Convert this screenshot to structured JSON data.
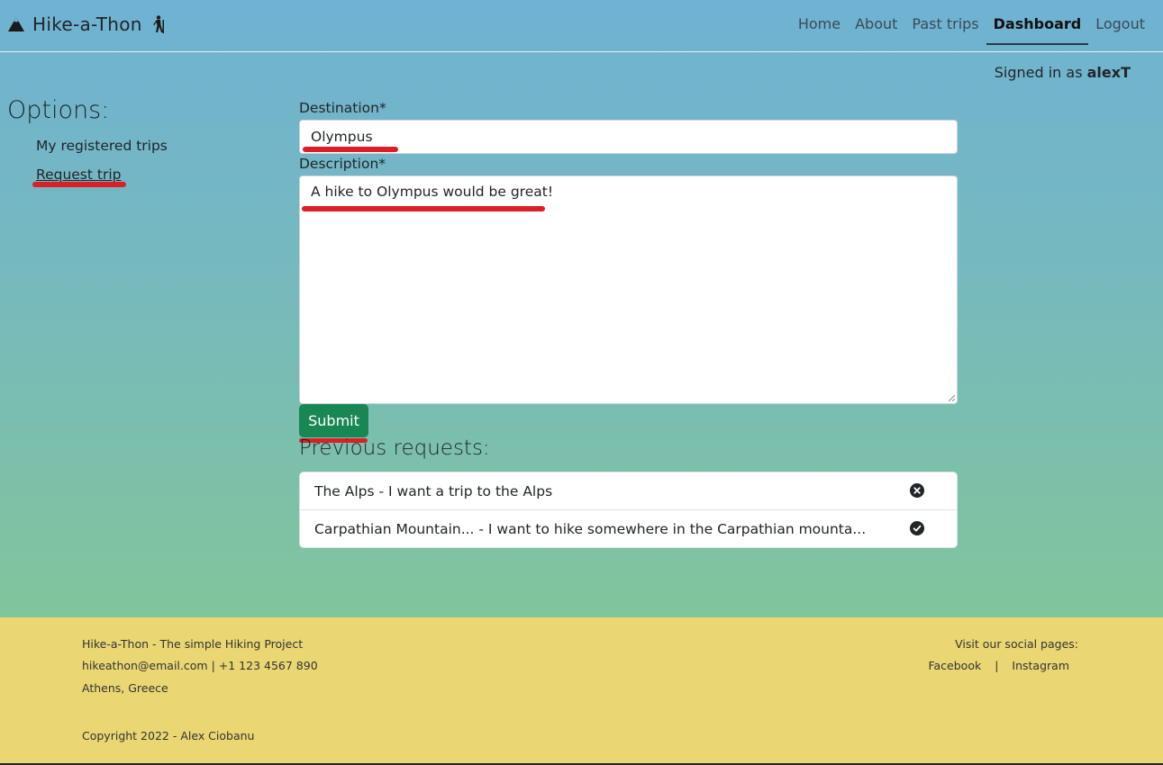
{
  "brand": {
    "name": "Hike-a-Thon"
  },
  "nav": {
    "home": "Home",
    "about": "About",
    "past": "Past trips",
    "dashboard": "Dashboard",
    "logout": "Logout"
  },
  "user": {
    "signed_prefix": "Signed in as",
    "name": "alexT"
  },
  "sidebar": {
    "title": "Options:",
    "items": [
      "My registered trips",
      "Request trip"
    ]
  },
  "form": {
    "dest_label": "Destination*",
    "dest_value": "Olympus",
    "desc_label": "Description*",
    "desc_value": "A hike to Olympus would be great!",
    "submit": "Submit"
  },
  "previous": {
    "title": "Previous requests:",
    "items": [
      {
        "text": "The Alps - I want a trip to the Alps",
        "status_icon": "times-circle-icon"
      },
      {
        "text": "Carpathian Mountain... - I want to hike somewhere in the Carpathian mounta...",
        "status_icon": "check-circle-icon"
      }
    ]
  },
  "footer": {
    "tagline": "Hike-a-Thon - The simple Hiking Project",
    "email": "hikeathon@email.com",
    "phone": "+1 123 4567 890",
    "sep": "|",
    "city": "Athens, Greece",
    "copyright": "Copyright 2022 - Alex Ciobanu",
    "social_title": "Visit our social pages:",
    "facebook": "Facebook",
    "instagram": "Instagram"
  },
  "colors": {
    "submit": "#198754",
    "footer": "#ead673",
    "annotation": "#dc1f26"
  }
}
